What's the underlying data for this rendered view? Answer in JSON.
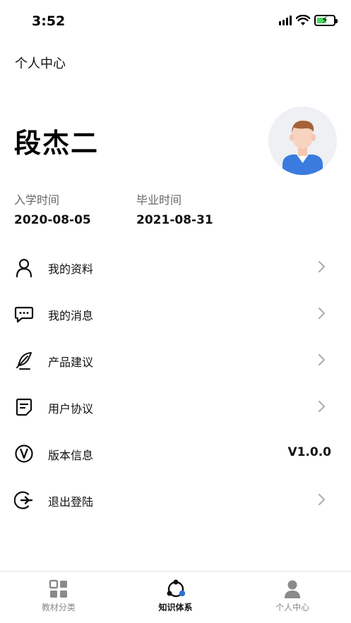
{
  "status_bar": {
    "time": "3:52"
  },
  "header": {
    "title": "个人中心"
  },
  "profile": {
    "name": "段杰二",
    "enroll_label": "入学时间",
    "enroll_date": "2020-08-05",
    "graduate_label": "毕业时间",
    "graduate_date": "2021-08-31"
  },
  "menu": {
    "items": [
      {
        "label": "我的资料",
        "icon": "user-icon"
      },
      {
        "label": "我的消息",
        "icon": "message-icon"
      },
      {
        "label": "产品建议",
        "icon": "feather-icon"
      },
      {
        "label": "用户协议",
        "icon": "document-icon"
      },
      {
        "label": "版本信息",
        "icon": "version-icon",
        "value": "V1.0.0"
      },
      {
        "label": "退出登陆",
        "icon": "logout-icon"
      }
    ]
  },
  "tabbar": {
    "tabs": [
      {
        "label": "教材分类",
        "icon": "grid-icon",
        "active": false
      },
      {
        "label": "知识体系",
        "icon": "network-icon",
        "active": true
      },
      {
        "label": "个人中心",
        "icon": "person-icon",
        "active": false
      }
    ]
  },
  "colors": {
    "accent": "#2f6fd6",
    "battery": "#4cd964",
    "muted": "#888888"
  }
}
